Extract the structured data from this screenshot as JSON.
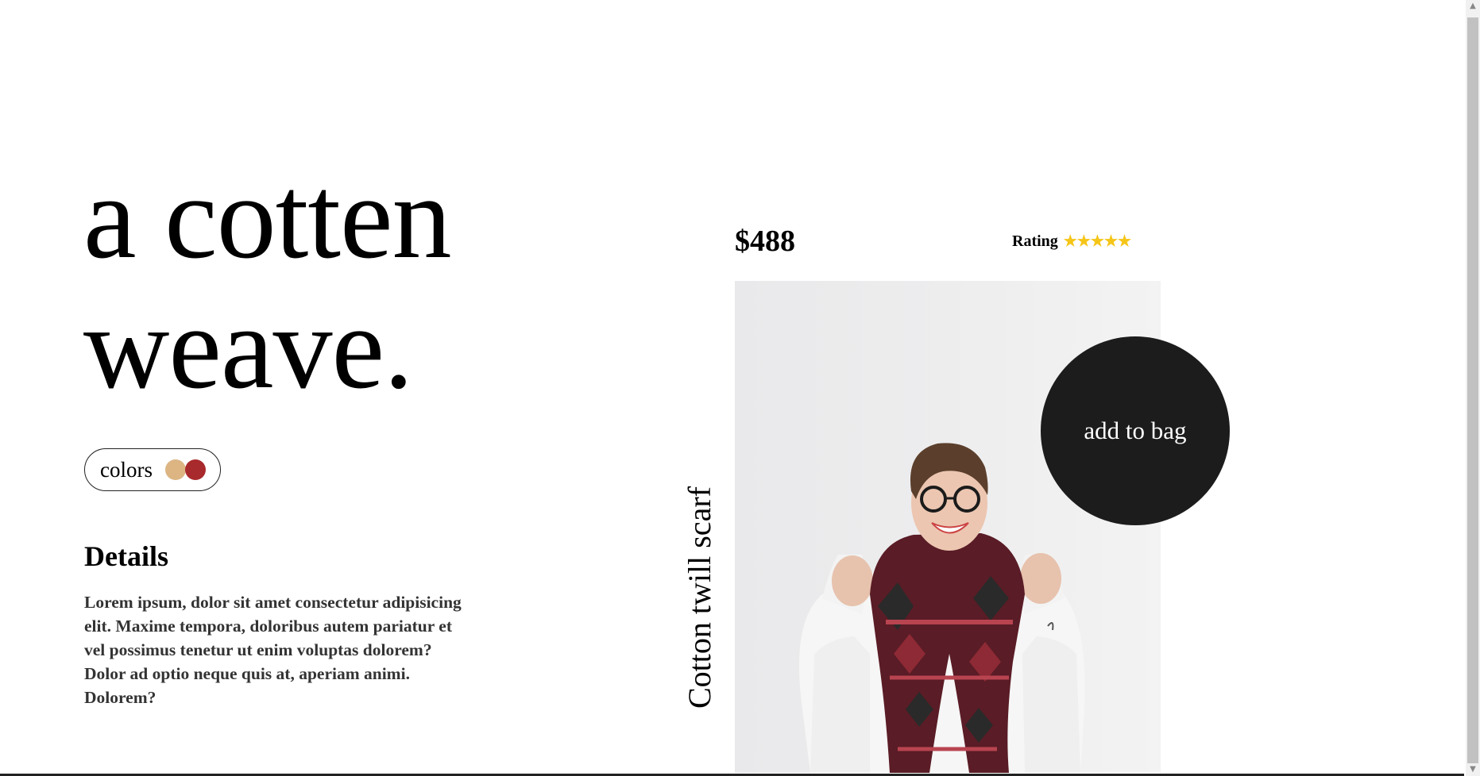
{
  "headline": {
    "line1": "a cotten",
    "line2": "weave."
  },
  "colors": {
    "label": "colors",
    "swatches": [
      {
        "name": "tan",
        "hex": "#dcb583"
      },
      {
        "name": "red",
        "hex": "#a92a2c"
      }
    ]
  },
  "details": {
    "title": "Details",
    "body": "Lorem ipsum, dolor sit amet consectetur adipisicing elit. Maxime tempora, doloribus autem pariatur et vel possimus tenetur ut enim voluptas dolorem? Dolor ad optio neque quis at, aperiam animi. Dolorem?"
  },
  "product": {
    "price": "$488",
    "rating_label": "Rating",
    "rating_stars": 5,
    "name": "Cotton twill scarf",
    "add_to_bag_label": "add to bag"
  },
  "theme": {
    "star_color": "#f5c518",
    "button_color": "#1c1c1c"
  },
  "scrollbar": {
    "up_arrow": "▲",
    "down_arrow": "▼"
  }
}
